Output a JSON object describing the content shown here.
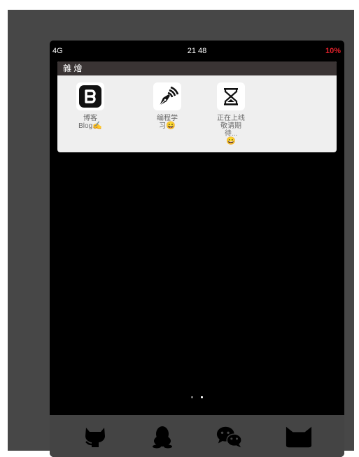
{
  "status": {
    "network": "4G",
    "time": "21 48",
    "battery": "10%"
  },
  "folder": {
    "title": "雜 燴",
    "apps": [
      {
        "label": "博客",
        "label2": "Blog",
        "icon": "blogger-icon",
        "emoji_icon": "writing-hand-icon"
      },
      {
        "label": "编程学",
        "label2": "习",
        "icon": "fountain-pen-icon",
        "emoji_icon": "smile-emoji-icon"
      },
      {
        "label": "正在上线敬请期待...",
        "label2": "",
        "icon": "hourglass-icon",
        "emoji_icon": "smile-emoji-icon"
      }
    ]
  },
  "pager": {
    "count": 2,
    "active": 1
  },
  "dock": [
    {
      "icon": "github-icon"
    },
    {
      "icon": "qq-penguin-icon"
    },
    {
      "icon": "wechat-icon"
    },
    {
      "icon": "cat-ears-icon"
    }
  ],
  "colors": {
    "battery_low": "#e0202a",
    "folder_header": "#3a3434",
    "dock_bg": "#444444",
    "frame_bg": "#474747"
  }
}
